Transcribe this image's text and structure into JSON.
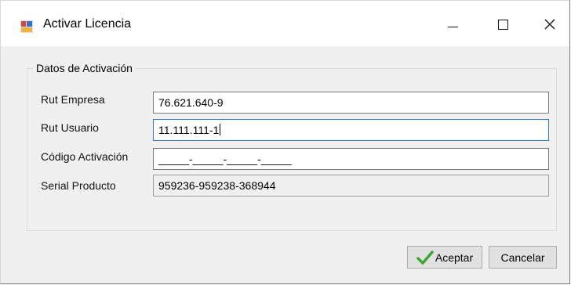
{
  "window": {
    "title": "Activar Licencia"
  },
  "group": {
    "title": "Datos de Activación"
  },
  "fields": {
    "rut_empresa": {
      "label": "Rut Empresa",
      "value": "76.621.640-9"
    },
    "rut_usuario": {
      "label": "Rut Usuario",
      "value": "11.111.111-1"
    },
    "codigo_activacion": {
      "label": "Código Activación",
      "value": "_____-_____-_____-_____"
    },
    "serial_producto": {
      "label": "Serial Producto",
      "value": "959236-959238-368944"
    }
  },
  "buttons": {
    "accept": "Aceptar",
    "cancel": "Cancelar"
  },
  "icons": {
    "app": "license-app-icon",
    "accept": "green-check-icon"
  },
  "colors": {
    "focus_border": "#2a7ad6",
    "check_green": "#3aa832"
  }
}
